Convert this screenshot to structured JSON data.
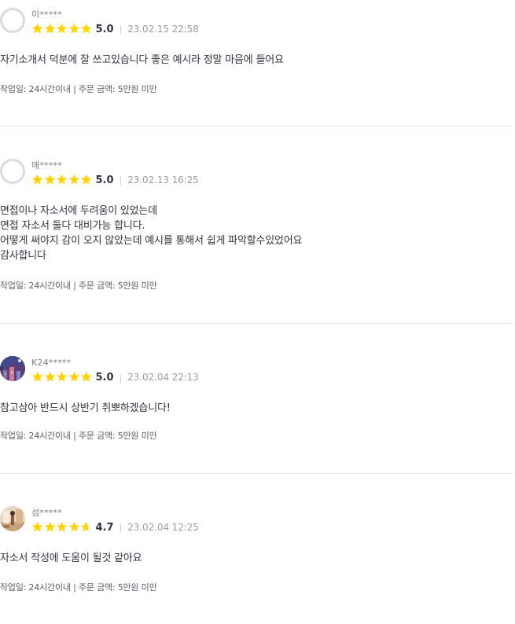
{
  "reviews": [
    {
      "username": "이*****",
      "avatar": "default-user-icon",
      "rating": 5.0,
      "score": "5.0",
      "date": "23.02.15 22:58",
      "body": "자기소개서 덕분에 잘 쓰고있습니다 좋은 예시라 정말 마음에 들어요",
      "meta": "작업일: 24시간이내 | 주문 금액: 5만원 미만"
    },
    {
      "username": "매*****",
      "avatar": "default-user-icon",
      "rating": 5.0,
      "score": "5.0",
      "date": "23.02.13 16:25",
      "body": "면접이나 자소서에 두려움이 있었는데\n면접 자소서 둘다 대비가능 합니다.\n어떻게 써야지 감이 오지 않았는데 예시를 통해서 쉽게 파악할수있었어요\n감사합니다",
      "meta": "작업일: 24시간이내 | 주문 금액: 5만원 미만"
    },
    {
      "username": "K24*****",
      "avatar": "photo-avatar-night-scene",
      "rating": 5.0,
      "score": "5.0",
      "date": "23.02.04 22:13",
      "body": "참고삼아 반드시 상반기 취뽀하겠습니다!",
      "meta": "작업일: 24시간이내 | 주문 금액: 5만원 미만"
    },
    {
      "username": "섬*****",
      "avatar": "photo-avatar-room",
      "rating": 4.7,
      "score": "4.7",
      "date": "23.02.04 12:25",
      "body": "자소서 작성에 도움이 될것 같아요",
      "meta": "작업일: 24시간이내 | 주문 금액: 5만원 미만"
    }
  ],
  "colors": {
    "star": "#FFD400",
    "star_empty": "#E4E5E9",
    "text": "#303441",
    "muted": "#9A9DA4",
    "divider": "#E4E5E9"
  }
}
